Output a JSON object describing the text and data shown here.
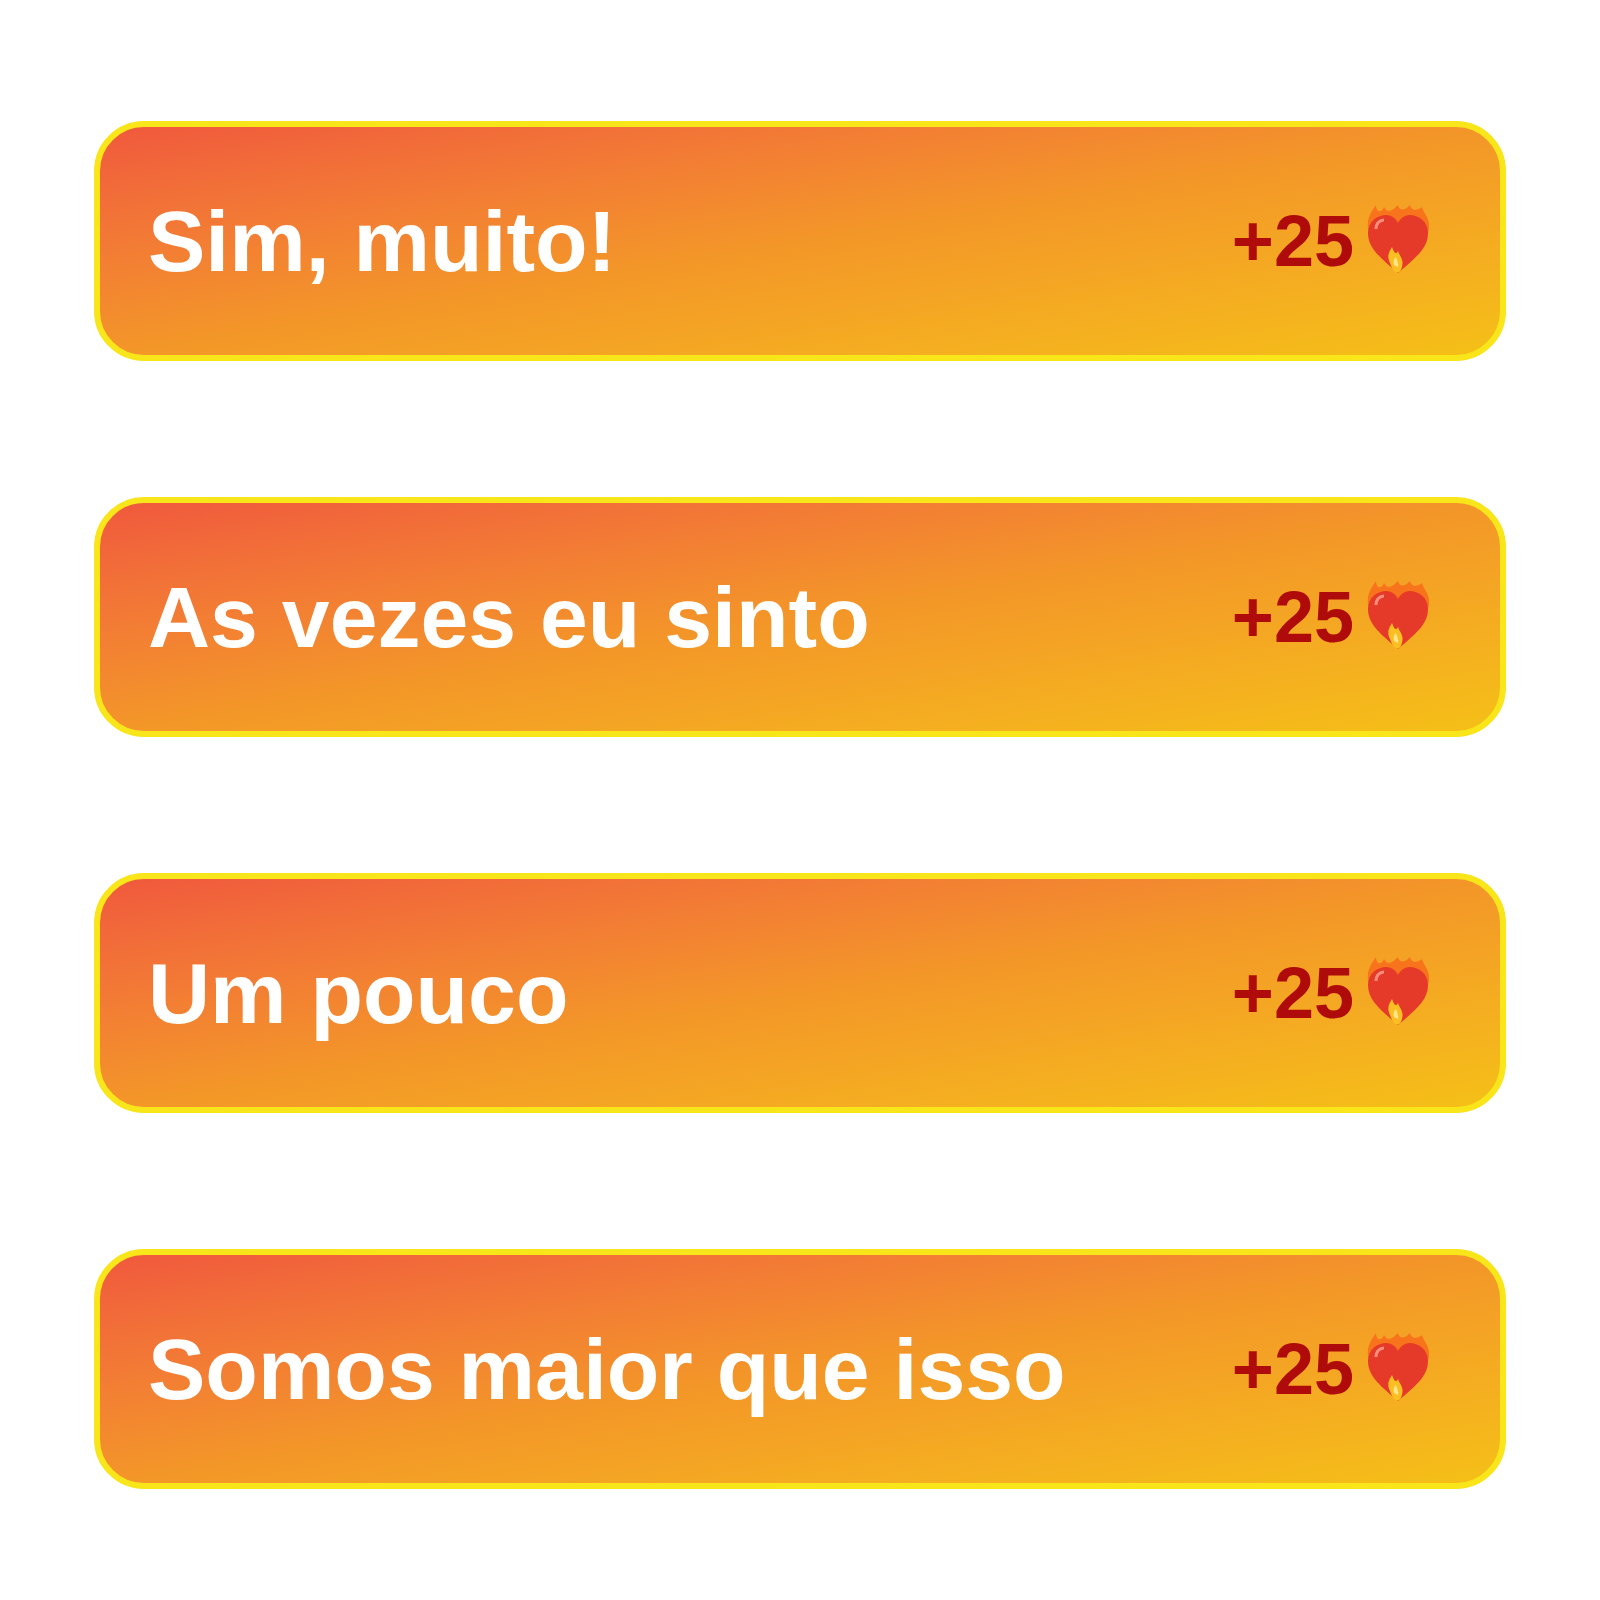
{
  "options": [
    {
      "label": "Sim, muito!",
      "points": "+25"
    },
    {
      "label": "As vezes eu sinto",
      "points": "+25"
    },
    {
      "label": "Um pouco",
      "points": "+25"
    },
    {
      "label": "Somos maior que isso",
      "points": "+25"
    }
  ]
}
